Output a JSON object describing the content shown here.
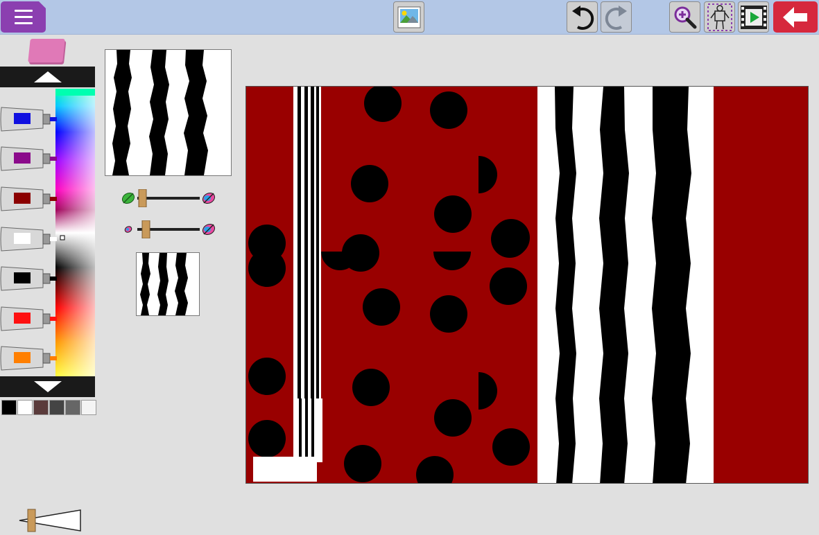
{
  "app": {
    "toolbar": {
      "menu": "menu-icon",
      "image": "image-icon",
      "undo": "undo-icon",
      "redo": "redo-icon",
      "zoom": "zoom-in-icon",
      "stamp": "stamp-icon",
      "film": "film-icon",
      "back": "back-arrow-icon"
    },
    "colors": {
      "toolbar_bg": "#b3c7e6",
      "menu_purple": "#8b3fb0",
      "back_red": "#d6283d",
      "canvas_red": "#990000",
      "eraser_pink": "#e079b7"
    },
    "paint_tubes": [
      {
        "name": "blue",
        "color": "#1010e0"
      },
      {
        "name": "purple",
        "color": "#8b0a8b"
      },
      {
        "name": "dark-red",
        "color": "#8b0000"
      },
      {
        "name": "white",
        "color": "#ffffff"
      },
      {
        "name": "black",
        "color": "#000000"
      },
      {
        "name": "red",
        "color": "#ff1010"
      },
      {
        "name": "orange",
        "color": "#ff7f00"
      }
    ],
    "swatches": [
      "#000000",
      "#ffffff",
      "#5a3b3b",
      "#444444",
      "#666666",
      "#f4f4f4"
    ]
  }
}
